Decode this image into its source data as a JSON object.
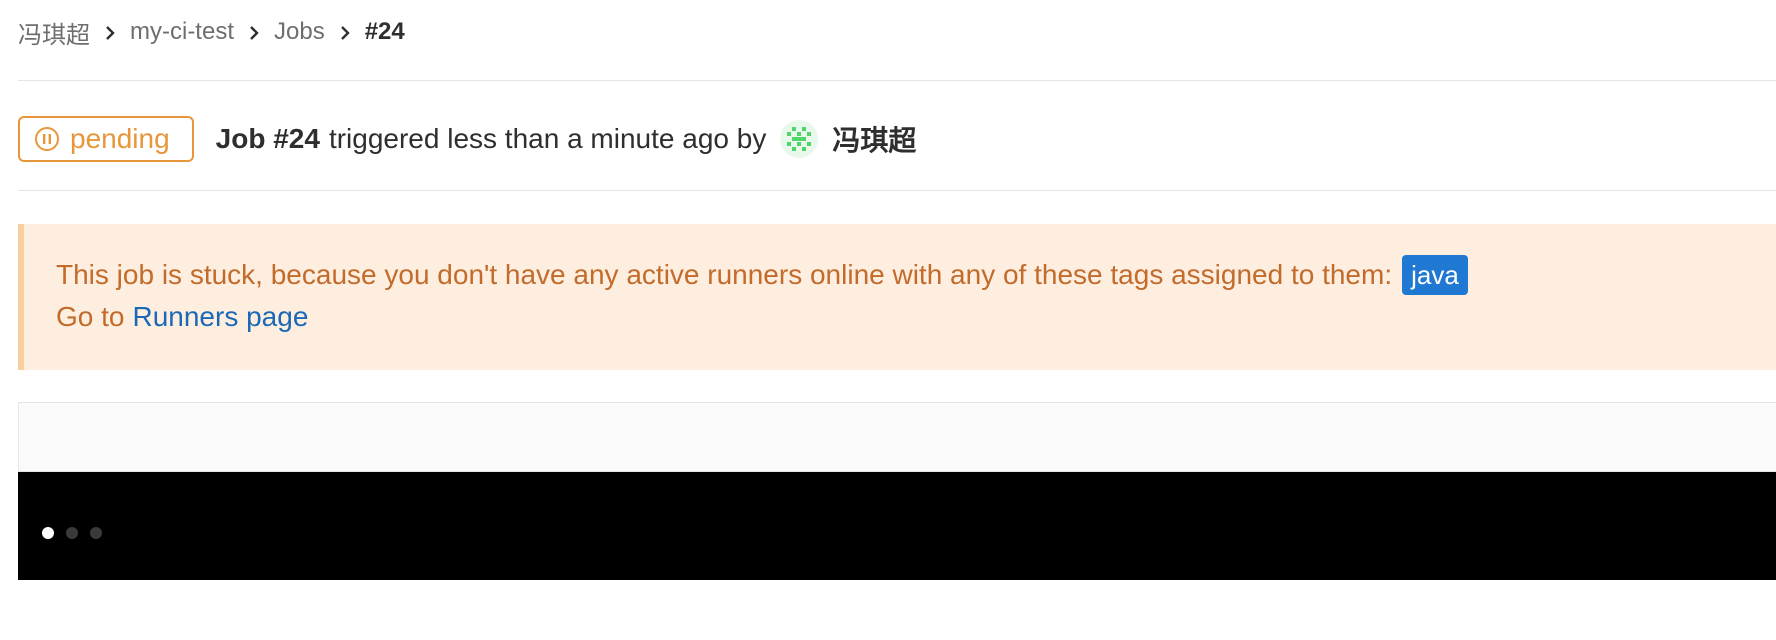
{
  "breadcrumb": {
    "items": [
      {
        "label": "冯琪超"
      },
      {
        "label": "my-ci-test"
      },
      {
        "label": "Jobs"
      }
    ],
    "current": "#24"
  },
  "job": {
    "status": {
      "label": "pending",
      "color": "#e8963a",
      "icon": "pause-circle-icon"
    },
    "title": "Job #24",
    "trigger_text": "triggered less than a minute ago by",
    "user": {
      "name": "冯琪超",
      "avatar": "identicon-avatar"
    }
  },
  "alert": {
    "message": "This job is stuck, because you don't have any active runners online with any of these tags assigned to them:",
    "tags": [
      "java"
    ],
    "goto_prefix": "Go to",
    "runners_link": "Runners page"
  },
  "log": {
    "loading_dots": 3,
    "active_dot": 0
  },
  "colors": {
    "pending": "#e8963a",
    "alert_bg": "#fdeee0",
    "alert_text": "#c26b2b",
    "link": "#1b69b6",
    "tag_bg": "#1f78d1"
  }
}
